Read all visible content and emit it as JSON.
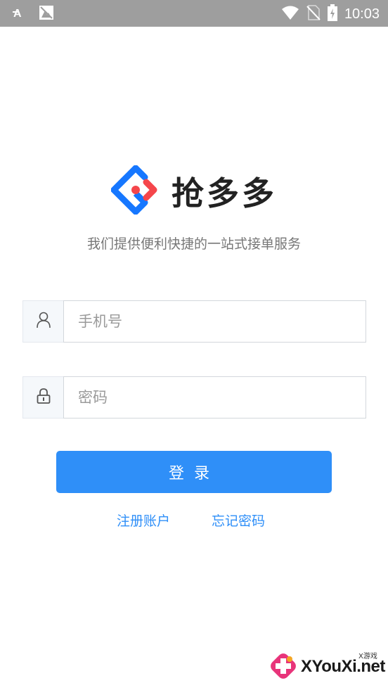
{
  "status_bar": {
    "time": "10:03",
    "icons": [
      "font-icon",
      "image-icon",
      "wifi-icon",
      "no-sim-icon",
      "battery-charging-icon"
    ]
  },
  "brand": {
    "name": "抢多多",
    "tagline": "我们提供便利快捷的一站式接单服务",
    "logo_colors": {
      "primary": "#1677ff",
      "accent": "#f5464b"
    }
  },
  "form": {
    "phone_placeholder": "手机号",
    "password_placeholder": "密码",
    "login_label": "登录"
  },
  "links": {
    "register": "注册账户",
    "forgot": "忘记密码"
  },
  "watermark": {
    "text": "XYouXi.net",
    "sub": "X游戏"
  },
  "colors": {
    "accent": "#2f8ff8",
    "status_bar": "#9e9e9e"
  }
}
